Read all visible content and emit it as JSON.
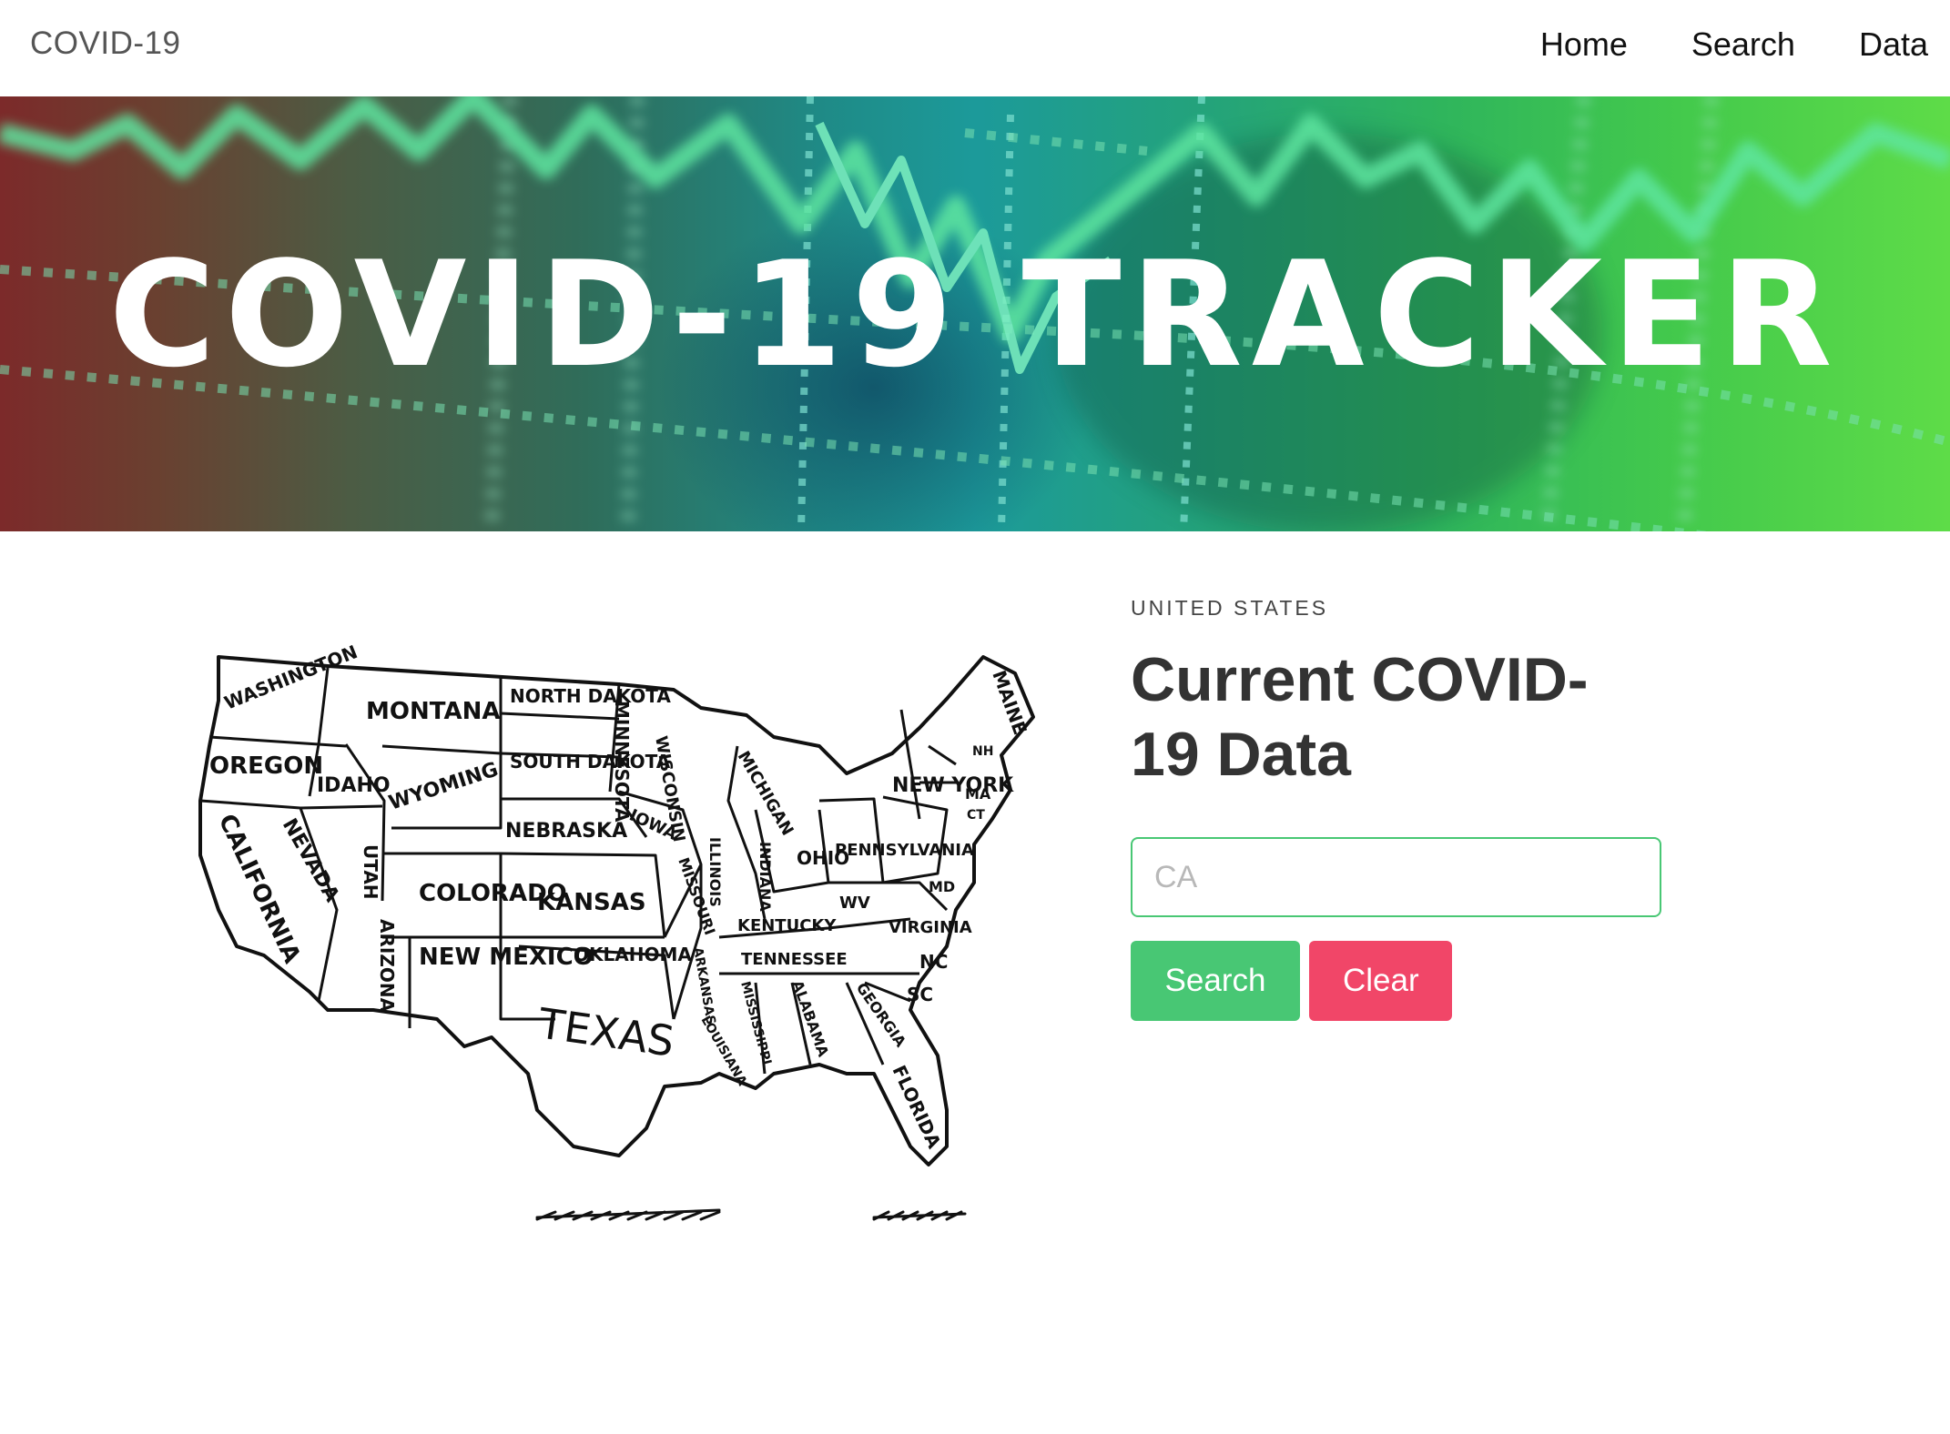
{
  "navbar": {
    "brand": "COVID-19",
    "links": [
      {
        "label": "Home"
      },
      {
        "label": "Search"
      },
      {
        "label": "Data"
      }
    ]
  },
  "hero": {
    "title": "COVID-19 TRACKER"
  },
  "map": {
    "states": [
      "WASHINGTON",
      "MONTANA",
      "NORTH DAKOTA",
      "MINNESOTA",
      "MAINE",
      "OREGON",
      "IDAHO",
      "SOUTH DAKOTA",
      "WISCONSIN",
      "MICHIGAN",
      "NEW YORK",
      "WYOMING",
      "NEBRASKA",
      "IOWA",
      "CALIFORNIA",
      "NEVADA",
      "UTAH",
      "COLORADO",
      "KANSAS",
      "ILLINOIS",
      "INDIANA",
      "OHIO",
      "PENNSYLVANIA",
      "MISSOURI",
      "KENTUCKY",
      "WV",
      "VIRGINIA",
      "MD",
      "NH",
      "MA",
      "CT",
      "ARIZONA",
      "NEW MEXICO",
      "OKLAHOMA",
      "ARKANSAS",
      "TENNESSEE",
      "NC",
      "SC",
      "TEXAS",
      "LOUISIANA",
      "MISSISSIPPI",
      "ALABAMA",
      "GEORGIA",
      "FLORIDA"
    ]
  },
  "panel": {
    "eyebrow": "UNITED STATES",
    "heading": "Current COVID-19 Data",
    "input_placeholder": "CA",
    "search_label": "Search",
    "clear_label": "Clear"
  },
  "colors": {
    "success": "#48c774",
    "danger": "#f14668"
  }
}
